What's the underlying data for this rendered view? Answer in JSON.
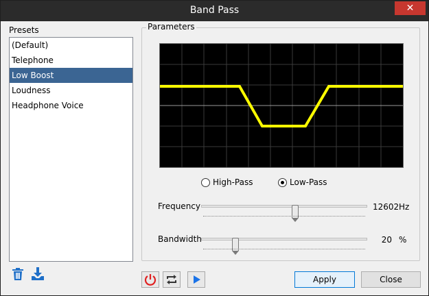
{
  "window": {
    "title": "Band Pass"
  },
  "presets": {
    "label": "Presets",
    "items": [
      {
        "label": "(Default)"
      },
      {
        "label": "Telephone"
      },
      {
        "label": "Low Boost"
      },
      {
        "label": "Loudness"
      },
      {
        "label": "Headphone Voice"
      }
    ],
    "selected_index": 2,
    "selected_color": "#3b6593"
  },
  "parameters": {
    "label": "Parameters",
    "filter_mode": {
      "options": [
        "High-Pass",
        "Low-Pass"
      ],
      "selected": "Low-Pass"
    },
    "frequency": {
      "label": "Frequency",
      "value": "12602",
      "unit": "Hz",
      "slider_fraction": 0.56
    },
    "bandwidth": {
      "label": "Bandwidth",
      "value": "20",
      "unit": "%",
      "slider_fraction": 0.2
    }
  },
  "graph": {
    "curve_color": "#ffff00",
    "grid": true
  },
  "toolbar": {
    "power_icon_color": "#e02020",
    "play_icon_color": "#1a73e8"
  },
  "buttons": {
    "apply": "Apply",
    "close": "Close"
  },
  "icons": {
    "delete": "trash-icon",
    "save": "download-icon"
  }
}
